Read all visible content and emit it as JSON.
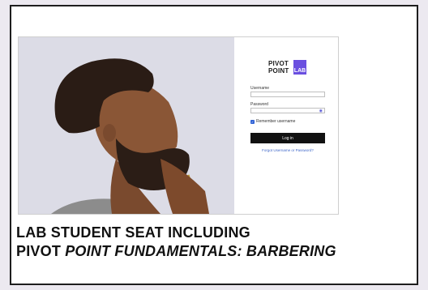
{
  "login": {
    "logo_line1": "PIVOT",
    "logo_line2": "POINT",
    "logo_badge": "LAB",
    "username_label": "Username",
    "username_value": "",
    "password_label": "Password",
    "password_value": "",
    "password_toggle_icon": "eye-icon",
    "remember_label": "Remember username",
    "remember_checked": true,
    "login_button": "Log in",
    "forgot_link": "Forgot Username or Password?"
  },
  "caption": {
    "line1": "LAB STUDENT SEAT INCLUDING",
    "line2_plain": "PIVOT ",
    "line2_italic": "POINT FUNDAMENTALS: BARBERING"
  },
  "colors": {
    "brand_purple": "#6a4fe0",
    "button_black": "#111111",
    "link_blue": "#3f67c9",
    "photo_bg": "#dcdce6"
  }
}
